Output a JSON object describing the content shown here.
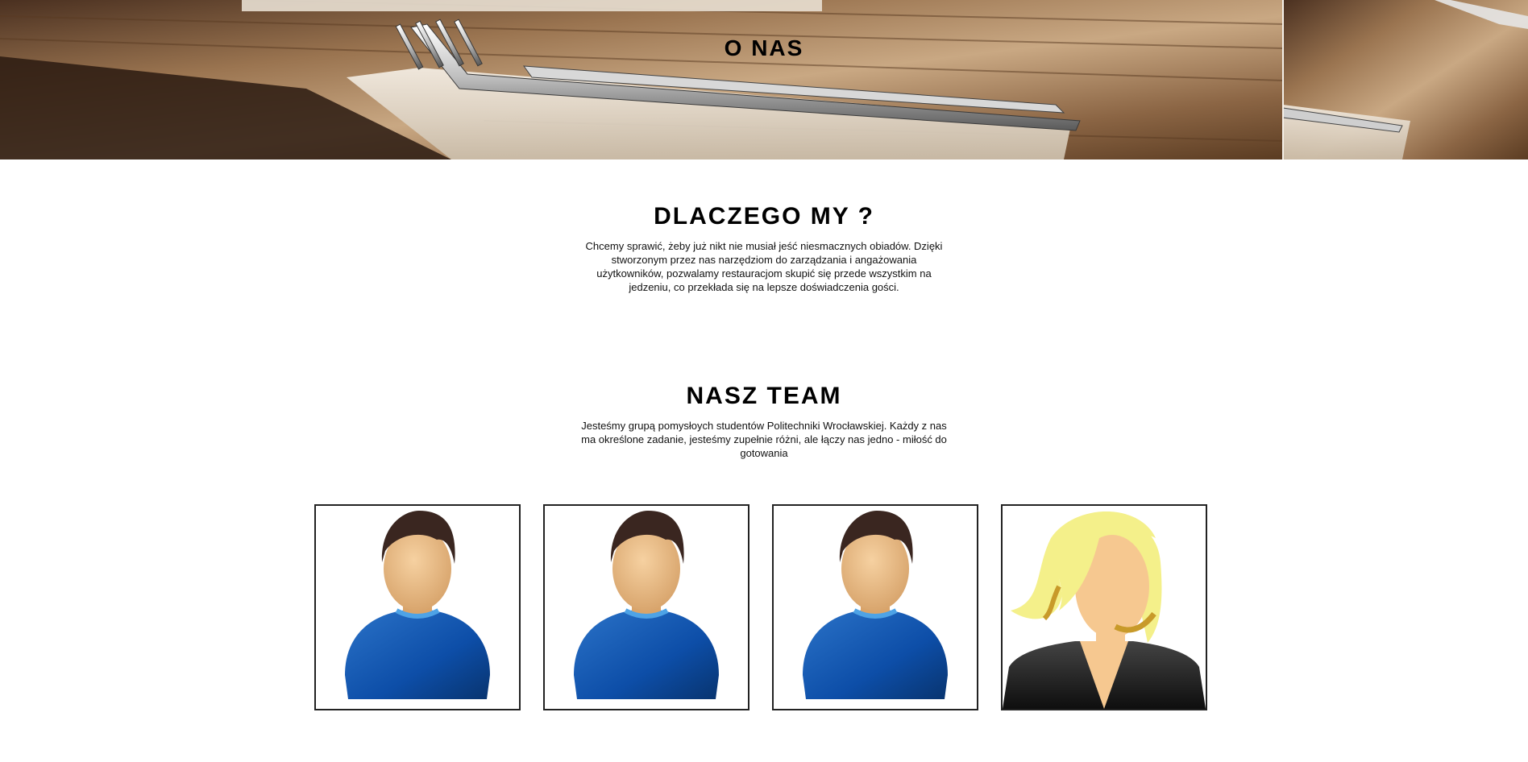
{
  "hero": {
    "title": "O NAS"
  },
  "why": {
    "title": "DLACZEGO MY ?",
    "text": "Chcemy sprawić, żeby już nikt nie musiał jeść niesmacznych obiadów. Dzięki stworzonym przez nas narzędziom do zarządzania i angażowania użytkowników, pozwalamy restauracjom skupić się przede wszystkim na jedzeniu, co przekłada się na lepsze doświadczenia gości."
  },
  "team": {
    "title": "NASZ TEAM",
    "text": "Jesteśmy grupą pomysłoych studentów Politechniki Wrocławskiej. Każdy z nas ma określone zadanie, jesteśmy zupełnie różni, ale łączy nas jedno - miłość do gotowania",
    "members": [
      {
        "avatar_icon": "male-avatar-icon"
      },
      {
        "avatar_icon": "male-avatar-icon"
      },
      {
        "avatar_icon": "male-avatar-icon"
      },
      {
        "avatar_icon": "female-avatar-icon"
      }
    ]
  }
}
